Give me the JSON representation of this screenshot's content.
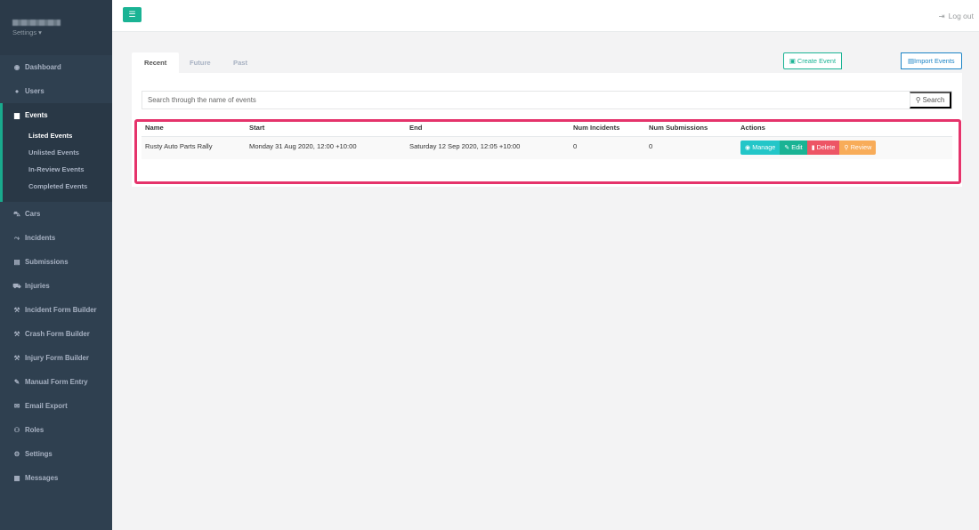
{
  "sidebar": {
    "settings_label": "Settings ▾",
    "items": [
      {
        "label": "Dashboard",
        "icon": "dashboard-icon",
        "glyph": "◉"
      },
      {
        "label": "Users",
        "icon": "users-icon",
        "glyph": "👥"
      },
      {
        "label": "Events",
        "icon": "calendar-icon",
        "glyph": "▆"
      },
      {
        "label": "Cars",
        "icon": "car-icon",
        "glyph": "⛍"
      },
      {
        "label": "Incidents",
        "icon": "crash-icon",
        "glyph": "⤳"
      },
      {
        "label": "Submissions",
        "icon": "file-icon",
        "glyph": "▤"
      },
      {
        "label": "Injuries",
        "icon": "ambulance-icon",
        "glyph": "⛟"
      },
      {
        "label": "Incident Form Builder",
        "icon": "wrench-icon",
        "glyph": "⚒"
      },
      {
        "label": "Crash Form Builder",
        "icon": "wrench-icon",
        "glyph": "⚒"
      },
      {
        "label": "Injury Form Builder",
        "icon": "wrench-icon",
        "glyph": "⚒"
      },
      {
        "label": "Manual Form Entry",
        "icon": "edit-icon",
        "glyph": "✎"
      },
      {
        "label": "Email Export",
        "icon": "envelope-icon",
        "glyph": "✉"
      },
      {
        "label": "Roles",
        "icon": "user-role-icon",
        "glyph": "⚇"
      },
      {
        "label": "Settings",
        "icon": "gear-icon",
        "glyph": "⚙"
      },
      {
        "label": "Messages",
        "icon": "messages-icon",
        "glyph": "▦"
      }
    ],
    "event_subitems": [
      "Listed Events",
      "Unlisted Events",
      "In-Review Events",
      "Completed Events"
    ]
  },
  "topbar": {
    "menu_glyph": "☰",
    "logout_label": "Log out",
    "logout_glyph": "⇥"
  },
  "tabs": [
    "Recent",
    "Future",
    "Past"
  ],
  "buttons": {
    "create_event": "Create Event",
    "import_events": "Import Events"
  },
  "search": {
    "placeholder": "Search through the name of events",
    "button_label": "Search"
  },
  "table": {
    "headers": [
      "Name",
      "Start",
      "End",
      "Num Incidents",
      "Num Submissions",
      "Actions"
    ],
    "rows": [
      {
        "name": "Rusty Auto Parts Rally",
        "start": "Monday 31 Aug 2020, 12:00 +10:00",
        "end": "Saturday 12 Sep 2020, 12:05 +10:00",
        "num_incidents": "0",
        "num_submissions": "0"
      }
    ],
    "actions": {
      "manage": "Manage",
      "edit": "Edit",
      "delete": "Delete",
      "review": "Review"
    }
  },
  "colors": {
    "sidebar_bg": "#2f4050",
    "accent": "#1ab394",
    "highlight": "#e5336b"
  }
}
